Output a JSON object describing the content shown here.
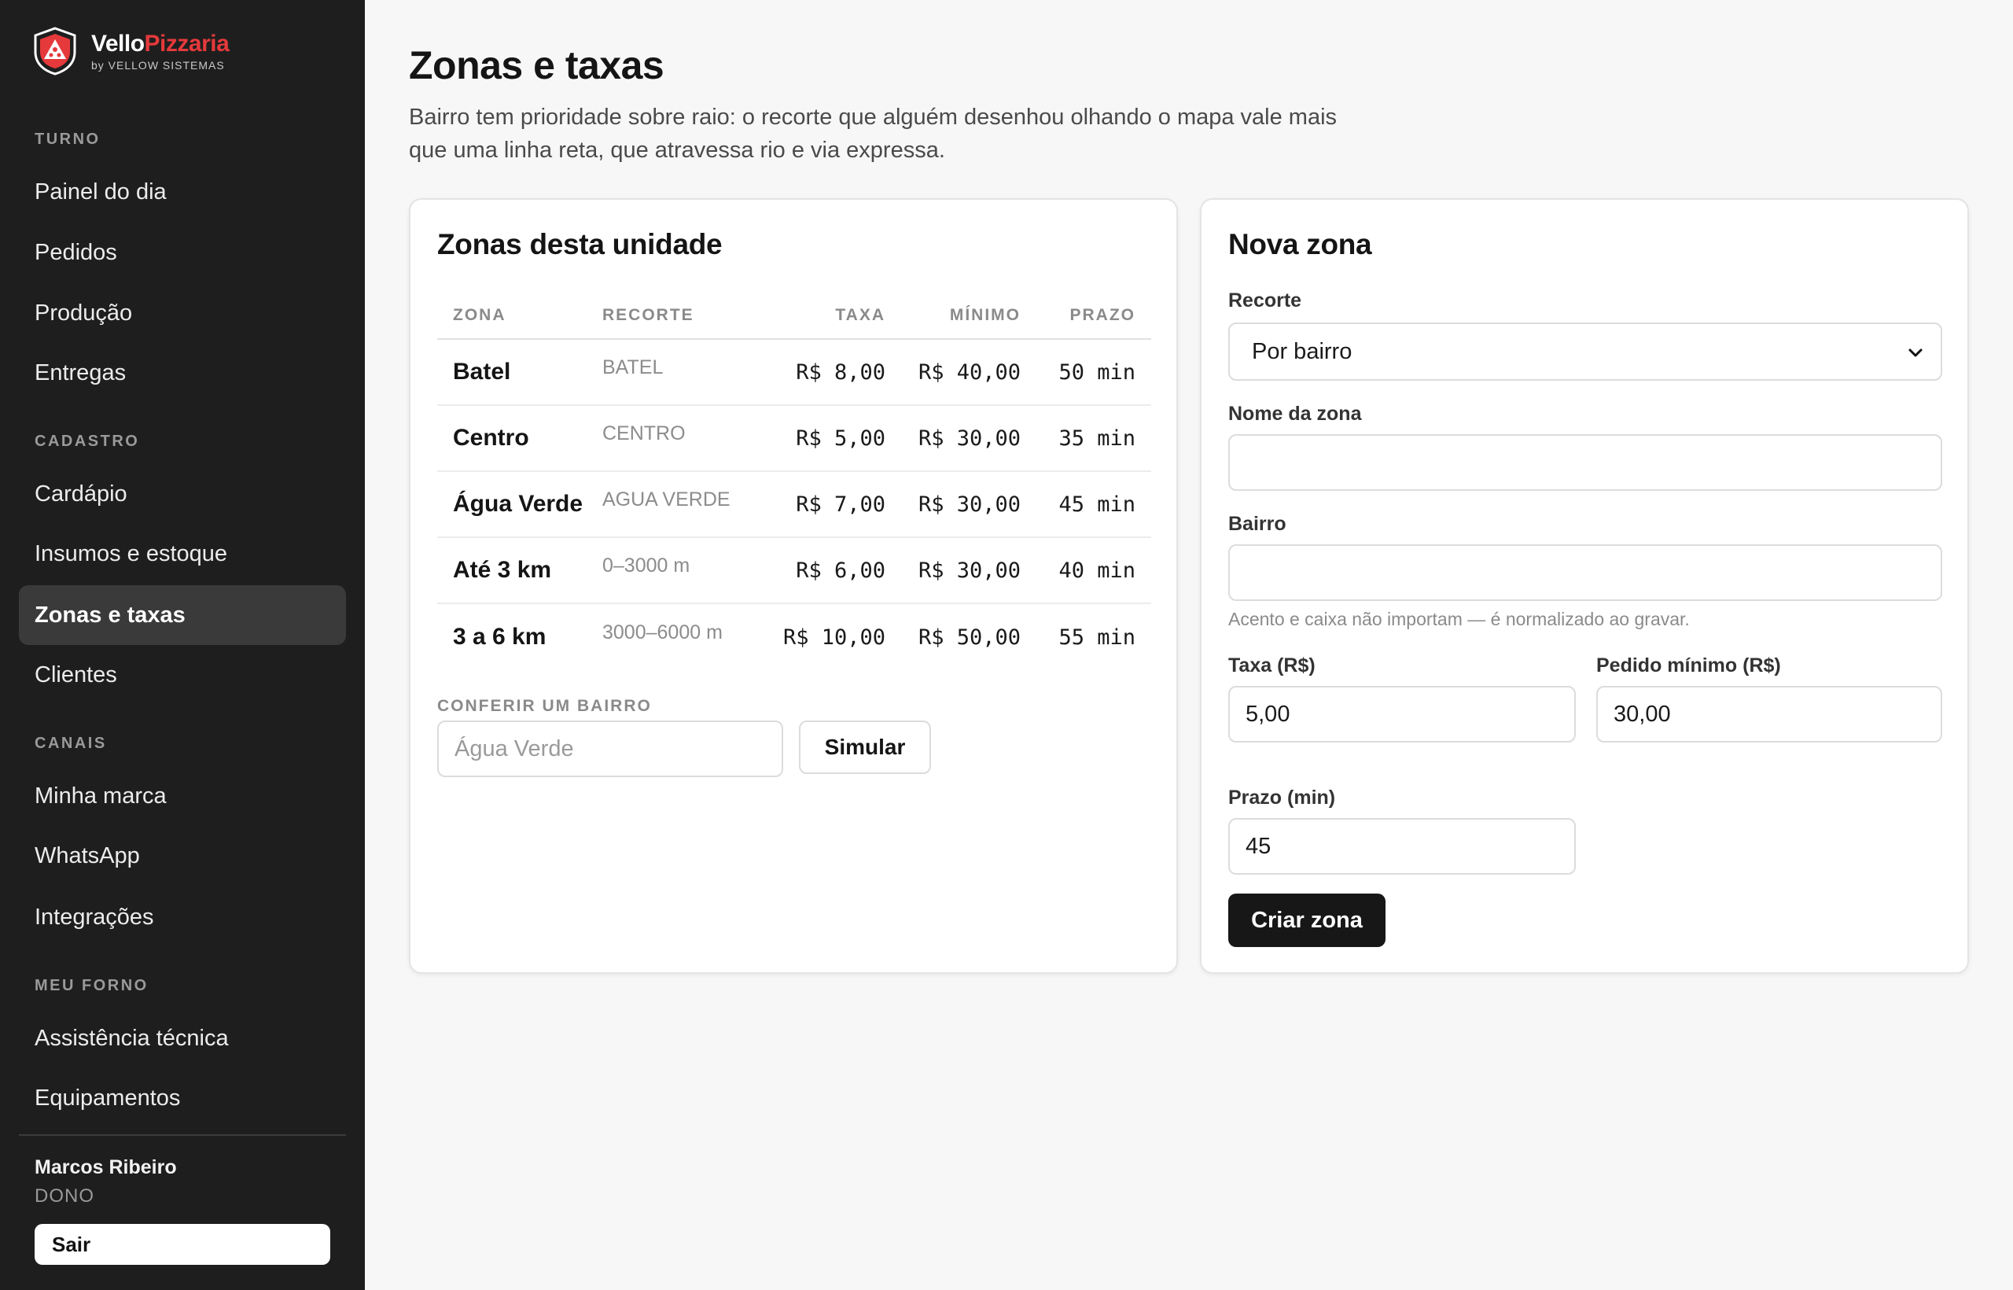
{
  "brand": {
    "name_part1": "Vello",
    "name_part2": "Pizzaria",
    "subtitle": "by VELLOW SISTEMAS"
  },
  "sidebar": {
    "sections": [
      {
        "title": "TURNO",
        "items": [
          "Painel do dia",
          "Pedidos",
          "Produção",
          "Entregas"
        ]
      },
      {
        "title": "CADASTRO",
        "items": [
          "Cardápio",
          "Insumos e estoque",
          "Zonas e taxas",
          "Clientes"
        ]
      },
      {
        "title": "CANAIS",
        "items": [
          "Minha marca",
          "WhatsApp",
          "Integrações"
        ]
      },
      {
        "title": "MEU FORNO",
        "items": [
          "Assistência técnica",
          "Equipamentos"
        ]
      }
    ],
    "active_item": "Zonas e taxas",
    "user": {
      "name": "Marcos Ribeiro",
      "role": "DONO"
    },
    "logout_label": "Sair"
  },
  "page": {
    "title": "Zonas e taxas",
    "description": "Bairro tem prioridade sobre raio: o recorte que alguém desenhou olhando o mapa vale mais que uma linha reta, que atravessa rio e via expressa."
  },
  "zones_card": {
    "title": "Zonas desta unidade",
    "columns": {
      "zone": "ZONA",
      "cut": "RECORTE",
      "fee": "TAXA",
      "minimum": "MÍNIMO",
      "due": "PRAZO"
    },
    "rows": [
      {
        "zone": "Batel",
        "cut": "BATEL",
        "fee": "R$ 8,00",
        "minimum": "R$ 40,00",
        "due": "50 min"
      },
      {
        "zone": "Centro",
        "cut": "CENTRO",
        "fee": "R$ 5,00",
        "minimum": "R$ 30,00",
        "due": "35 min"
      },
      {
        "zone": "Água Verde",
        "cut": "AGUA VERDE",
        "fee": "R$ 7,00",
        "minimum": "R$ 30,00",
        "due": "45 min"
      },
      {
        "zone": "Até 3 km",
        "cut": "0–3000 m",
        "fee": "R$ 6,00",
        "minimum": "R$ 30,00",
        "due": "40 min"
      },
      {
        "zone": "3 a 6 km",
        "cut": "3000–6000 m",
        "fee": "R$ 10,00",
        "minimum": "R$ 50,00",
        "due": "55 min"
      }
    ],
    "check": {
      "label": "CONFERIR UM BAIRRO",
      "placeholder": "Água Verde",
      "button": "Simular"
    }
  },
  "new_zone_card": {
    "title": "Nova zona",
    "cut_label": "Recorte",
    "cut_value": "Por bairro",
    "name_label": "Nome da zona",
    "name_value": "",
    "district_label": "Bairro",
    "district_value": "",
    "district_hint": "Acento e caixa não importam — é normalizado ao gravar.",
    "fee_label": "Taxa (R$)",
    "fee_value": "5,00",
    "minimum_label": "Pedido mínimo (R$)",
    "minimum_value": "30,00",
    "due_label": "Prazo (min)",
    "due_value": "45",
    "submit": "Criar zona"
  }
}
